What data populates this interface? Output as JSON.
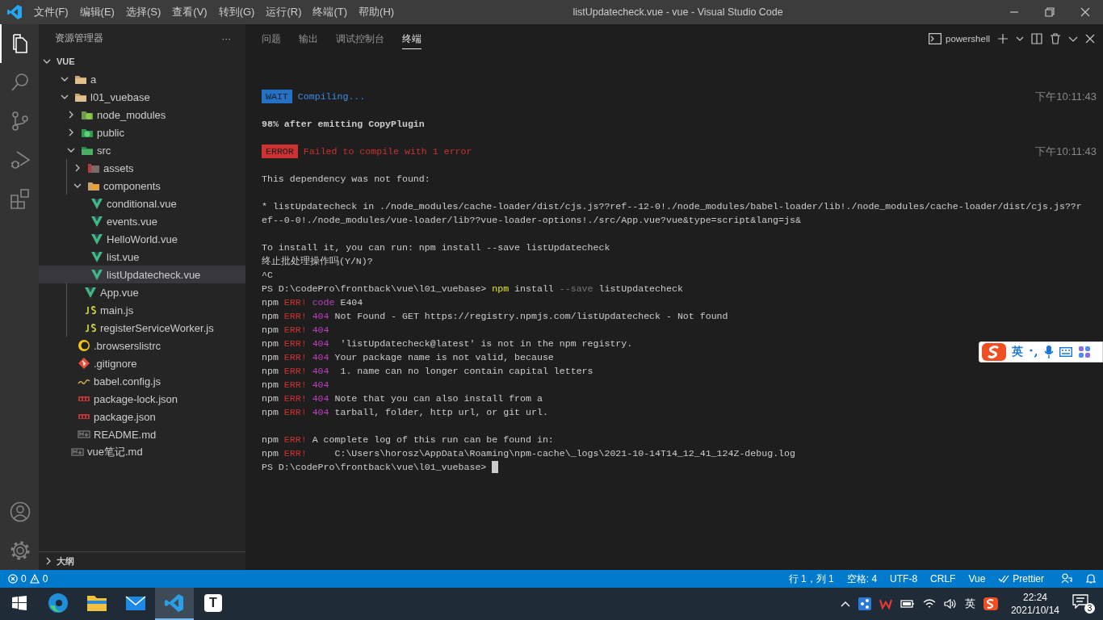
{
  "window": {
    "title": "listUpdatecheck.vue - vue - Visual Studio Code"
  },
  "menu": [
    "文件(F)",
    "编辑(E)",
    "选择(S)",
    "查看(V)",
    "转到(G)",
    "运行(R)",
    "终端(T)",
    "帮助(H)"
  ],
  "activity_bar": [
    {
      "kind": "files",
      "selected": true
    },
    {
      "kind": "search",
      "selected": false
    },
    {
      "kind": "source-control",
      "selected": false
    },
    {
      "kind": "run",
      "selected": false
    },
    {
      "kind": "extensions",
      "selected": false
    }
  ],
  "explorer": {
    "title": "资源管理器",
    "more": "···",
    "section": {
      "label": "VUE",
      "expanded": true
    },
    "tree": [
      {
        "label": "a",
        "kind": "folder",
        "expanded": true,
        "selected": false
      },
      {
        "label": "l01_vuebase",
        "kind": "folder",
        "expanded": true,
        "selected": false,
        "children": [
          {
            "label": "node_modules",
            "kind": "folder-node",
            "expanded": false,
            "selected": false
          },
          {
            "label": "public",
            "kind": "folder-public",
            "expanded": false,
            "selected": false
          },
          {
            "label": "src",
            "kind": "folder-src",
            "expanded": true,
            "selected": false,
            "children": [
              {
                "label": "assets",
                "kind": "folder-assets",
                "expanded": false,
                "selected": false
              },
              {
                "label": "components",
                "kind": "folder-components",
                "expanded": true,
                "selected": false,
                "children": [
                  {
                    "label": "conditional.vue",
                    "kind": "vue",
                    "selected": false
                  },
                  {
                    "label": "events.vue",
                    "kind": "vue",
                    "selected": false
                  },
                  {
                    "label": "HelloWorld.vue",
                    "kind": "vue",
                    "selected": false
                  },
                  {
                    "label": "list.vue",
                    "kind": "vue",
                    "selected": false
                  },
                  {
                    "label": "listUpdatecheck.vue",
                    "kind": "vue",
                    "selected": true
                  }
                ]
              },
              {
                "label": "App.vue",
                "kind": "vue",
                "selected": false
              },
              {
                "label": "main.js",
                "kind": "js",
                "selected": false
              },
              {
                "label": "registerServiceWorker.js",
                "kind": "js",
                "selected": false
              }
            ]
          },
          {
            "label": ".browserslistrc",
            "kind": "browserslist",
            "selected": false
          },
          {
            "label": ".gitignore",
            "kind": "git",
            "selected": false
          },
          {
            "label": "babel.config.js",
            "kind": "babel",
            "selected": false
          },
          {
            "label": "package-lock.json",
            "kind": "npm",
            "selected": false
          },
          {
            "label": "package.json",
            "kind": "npm",
            "selected": false
          },
          {
            "label": "README.md",
            "kind": "md",
            "selected": false
          }
        ]
      },
      {
        "label": "vue笔记.md",
        "kind": "md",
        "selected": false
      }
    ],
    "outline": {
      "label": "大纲",
      "expanded": false
    }
  },
  "panel": {
    "tabs": [
      {
        "label": "问题",
        "selected": false
      },
      {
        "label": "输出",
        "selected": false
      },
      {
        "label": "调试控制台",
        "selected": false
      },
      {
        "label": "终端",
        "selected": true
      }
    ],
    "shell": "powershell",
    "terminal": [
      {
        "kind": "blank"
      },
      {
        "kind": "blank"
      },
      {
        "kind": "text",
        "time": "下午10:11:43",
        "segments": [
          {
            "text": "WAIT",
            "kind": "badge-wait"
          },
          {
            "text": " Compiling...",
            "kind": "wait"
          }
        ]
      },
      {
        "kind": "blank"
      },
      {
        "kind": "text",
        "segments": [
          {
            "text": "98% after emitting CopyPlugin",
            "kind": "bold"
          }
        ]
      },
      {
        "kind": "blank"
      },
      {
        "kind": "text",
        "time": "下午10:11:43",
        "segments": [
          {
            "text": "ERROR",
            "kind": "badge-error"
          },
          {
            "text": " Failed to compile with 1 error",
            "kind": "error"
          }
        ]
      },
      {
        "kind": "blank"
      },
      {
        "kind": "text",
        "segments": [
          {
            "text": "This dependency was not found:",
            "kind": "plain"
          }
        ]
      },
      {
        "kind": "blank"
      },
      {
        "kind": "text",
        "segments": [
          {
            "text": "* listUpdatecheck in ./node_modules/cache-loader/dist/cjs.js??ref--12-0!./node_modules/babel-loader/lib!./node_modules/cache-loader/dist/cjs.js??r",
            "kind": "plain"
          }
        ]
      },
      {
        "kind": "text",
        "segments": [
          {
            "text": "ef--0-0!./node_modules/vue-loader/lib??vue-loader-options!./src/App.vue?vue&type=script&lang=js&",
            "kind": "plain"
          }
        ]
      },
      {
        "kind": "blank"
      },
      {
        "kind": "text",
        "segments": [
          {
            "text": "To install it, you can run: npm install --save listUpdatecheck",
            "kind": "plain"
          }
        ]
      },
      {
        "kind": "text",
        "segments": [
          {
            "text": "终止批处理操作吗(Y/N)?",
            "kind": "plain"
          }
        ]
      },
      {
        "kind": "text",
        "segments": [
          {
            "text": "^C",
            "kind": "plain"
          }
        ]
      },
      {
        "kind": "text",
        "segments": [
          {
            "text": "PS D:\\codePro\\frontback\\vue\\l01_vuebase> ",
            "kind": "plain"
          },
          {
            "text": "npm",
            "kind": "cmd"
          },
          {
            "text": " install ",
            "kind": "plain"
          },
          {
            "text": "--save",
            "kind": "flag"
          },
          {
            "text": " listUpdatecheck",
            "kind": "plain"
          }
        ]
      },
      {
        "kind": "text",
        "segments": [
          {
            "text": "npm ",
            "kind": "plain"
          },
          {
            "text": "ERR!",
            "kind": "err"
          },
          {
            "text": " code",
            "kind": "num"
          },
          {
            "text": " E404",
            "kind": "plain"
          }
        ]
      },
      {
        "kind": "text",
        "segments": [
          {
            "text": "npm ",
            "kind": "plain"
          },
          {
            "text": "ERR!",
            "kind": "err"
          },
          {
            "text": " 404",
            "kind": "num"
          },
          {
            "text": " Not Found - GET https://registry.npmjs.com/listUpdatecheck - Not found",
            "kind": "plain"
          }
        ]
      },
      {
        "kind": "text",
        "segments": [
          {
            "text": "npm ",
            "kind": "plain"
          },
          {
            "text": "ERR!",
            "kind": "err"
          },
          {
            "text": " 404",
            "kind": "num"
          }
        ]
      },
      {
        "kind": "text",
        "segments": [
          {
            "text": "npm ",
            "kind": "plain"
          },
          {
            "text": "ERR!",
            "kind": "err"
          },
          {
            "text": " 404",
            "kind": "num"
          },
          {
            "text": "  'listUpdatecheck@latest' is not in the npm registry.",
            "kind": "plain"
          }
        ]
      },
      {
        "kind": "text",
        "segments": [
          {
            "text": "npm ",
            "kind": "plain"
          },
          {
            "text": "ERR!",
            "kind": "err"
          },
          {
            "text": " 404",
            "kind": "num"
          },
          {
            "text": " Your package name is not valid, because",
            "kind": "plain"
          }
        ]
      },
      {
        "kind": "text",
        "segments": [
          {
            "text": "npm ",
            "kind": "plain"
          },
          {
            "text": "ERR!",
            "kind": "err"
          },
          {
            "text": " 404",
            "kind": "num"
          },
          {
            "text": "  1. name can no longer contain capital letters",
            "kind": "plain"
          }
        ]
      },
      {
        "kind": "text",
        "segments": [
          {
            "text": "npm ",
            "kind": "plain"
          },
          {
            "text": "ERR!",
            "kind": "err"
          },
          {
            "text": " 404",
            "kind": "num"
          }
        ]
      },
      {
        "kind": "text",
        "segments": [
          {
            "text": "npm ",
            "kind": "plain"
          },
          {
            "text": "ERR!",
            "kind": "err"
          },
          {
            "text": " 404",
            "kind": "num"
          },
          {
            "text": " Note that you can also install from a",
            "kind": "plain"
          }
        ]
      },
      {
        "kind": "text",
        "segments": [
          {
            "text": "npm ",
            "kind": "plain"
          },
          {
            "text": "ERR!",
            "kind": "err"
          },
          {
            "text": " 404",
            "kind": "num"
          },
          {
            "text": " tarball, folder, http url, or git url.",
            "kind": "plain"
          }
        ]
      },
      {
        "kind": "blank"
      },
      {
        "kind": "text",
        "segments": [
          {
            "text": "npm ",
            "kind": "plain"
          },
          {
            "text": "ERR!",
            "kind": "err"
          },
          {
            "text": " A complete log of this run can be found in:",
            "kind": "plain"
          }
        ]
      },
      {
        "kind": "text",
        "segments": [
          {
            "text": "npm ",
            "kind": "plain"
          },
          {
            "text": "ERR!",
            "kind": "err"
          },
          {
            "text": "     C:\\Users\\horosz\\AppData\\Roaming\\npm-cache\\_logs\\2021-10-14T14_12_41_124Z-debug.log",
            "kind": "plain"
          }
        ]
      },
      {
        "kind": "prompt",
        "segments": [
          {
            "text": "PS D:\\codePro\\frontback\\vue\\l01_vuebase> ",
            "kind": "plain"
          }
        ]
      }
    ]
  },
  "ime_toolbar": {
    "mode": "英"
  },
  "status_bar": {
    "errors": "0",
    "warnings": "0",
    "items": [
      "行 1，列 1",
      "空格: 4",
      "UTF-8",
      "CRLF",
      "Vue"
    ],
    "formatter": "Prettier"
  },
  "taskbar": {
    "apps": [
      {
        "kind": "windows",
        "selected": false
      },
      {
        "kind": "edge",
        "selected": false
      },
      {
        "kind": "explorer",
        "selected": false
      },
      {
        "kind": "mail",
        "selected": false
      },
      {
        "kind": "vscode",
        "selected": true
      },
      {
        "kind": "typora",
        "label": "T",
        "selected": false
      }
    ],
    "input_mode": "英",
    "time": "22:24",
    "date": "2021/10/14",
    "notifications": "3"
  }
}
